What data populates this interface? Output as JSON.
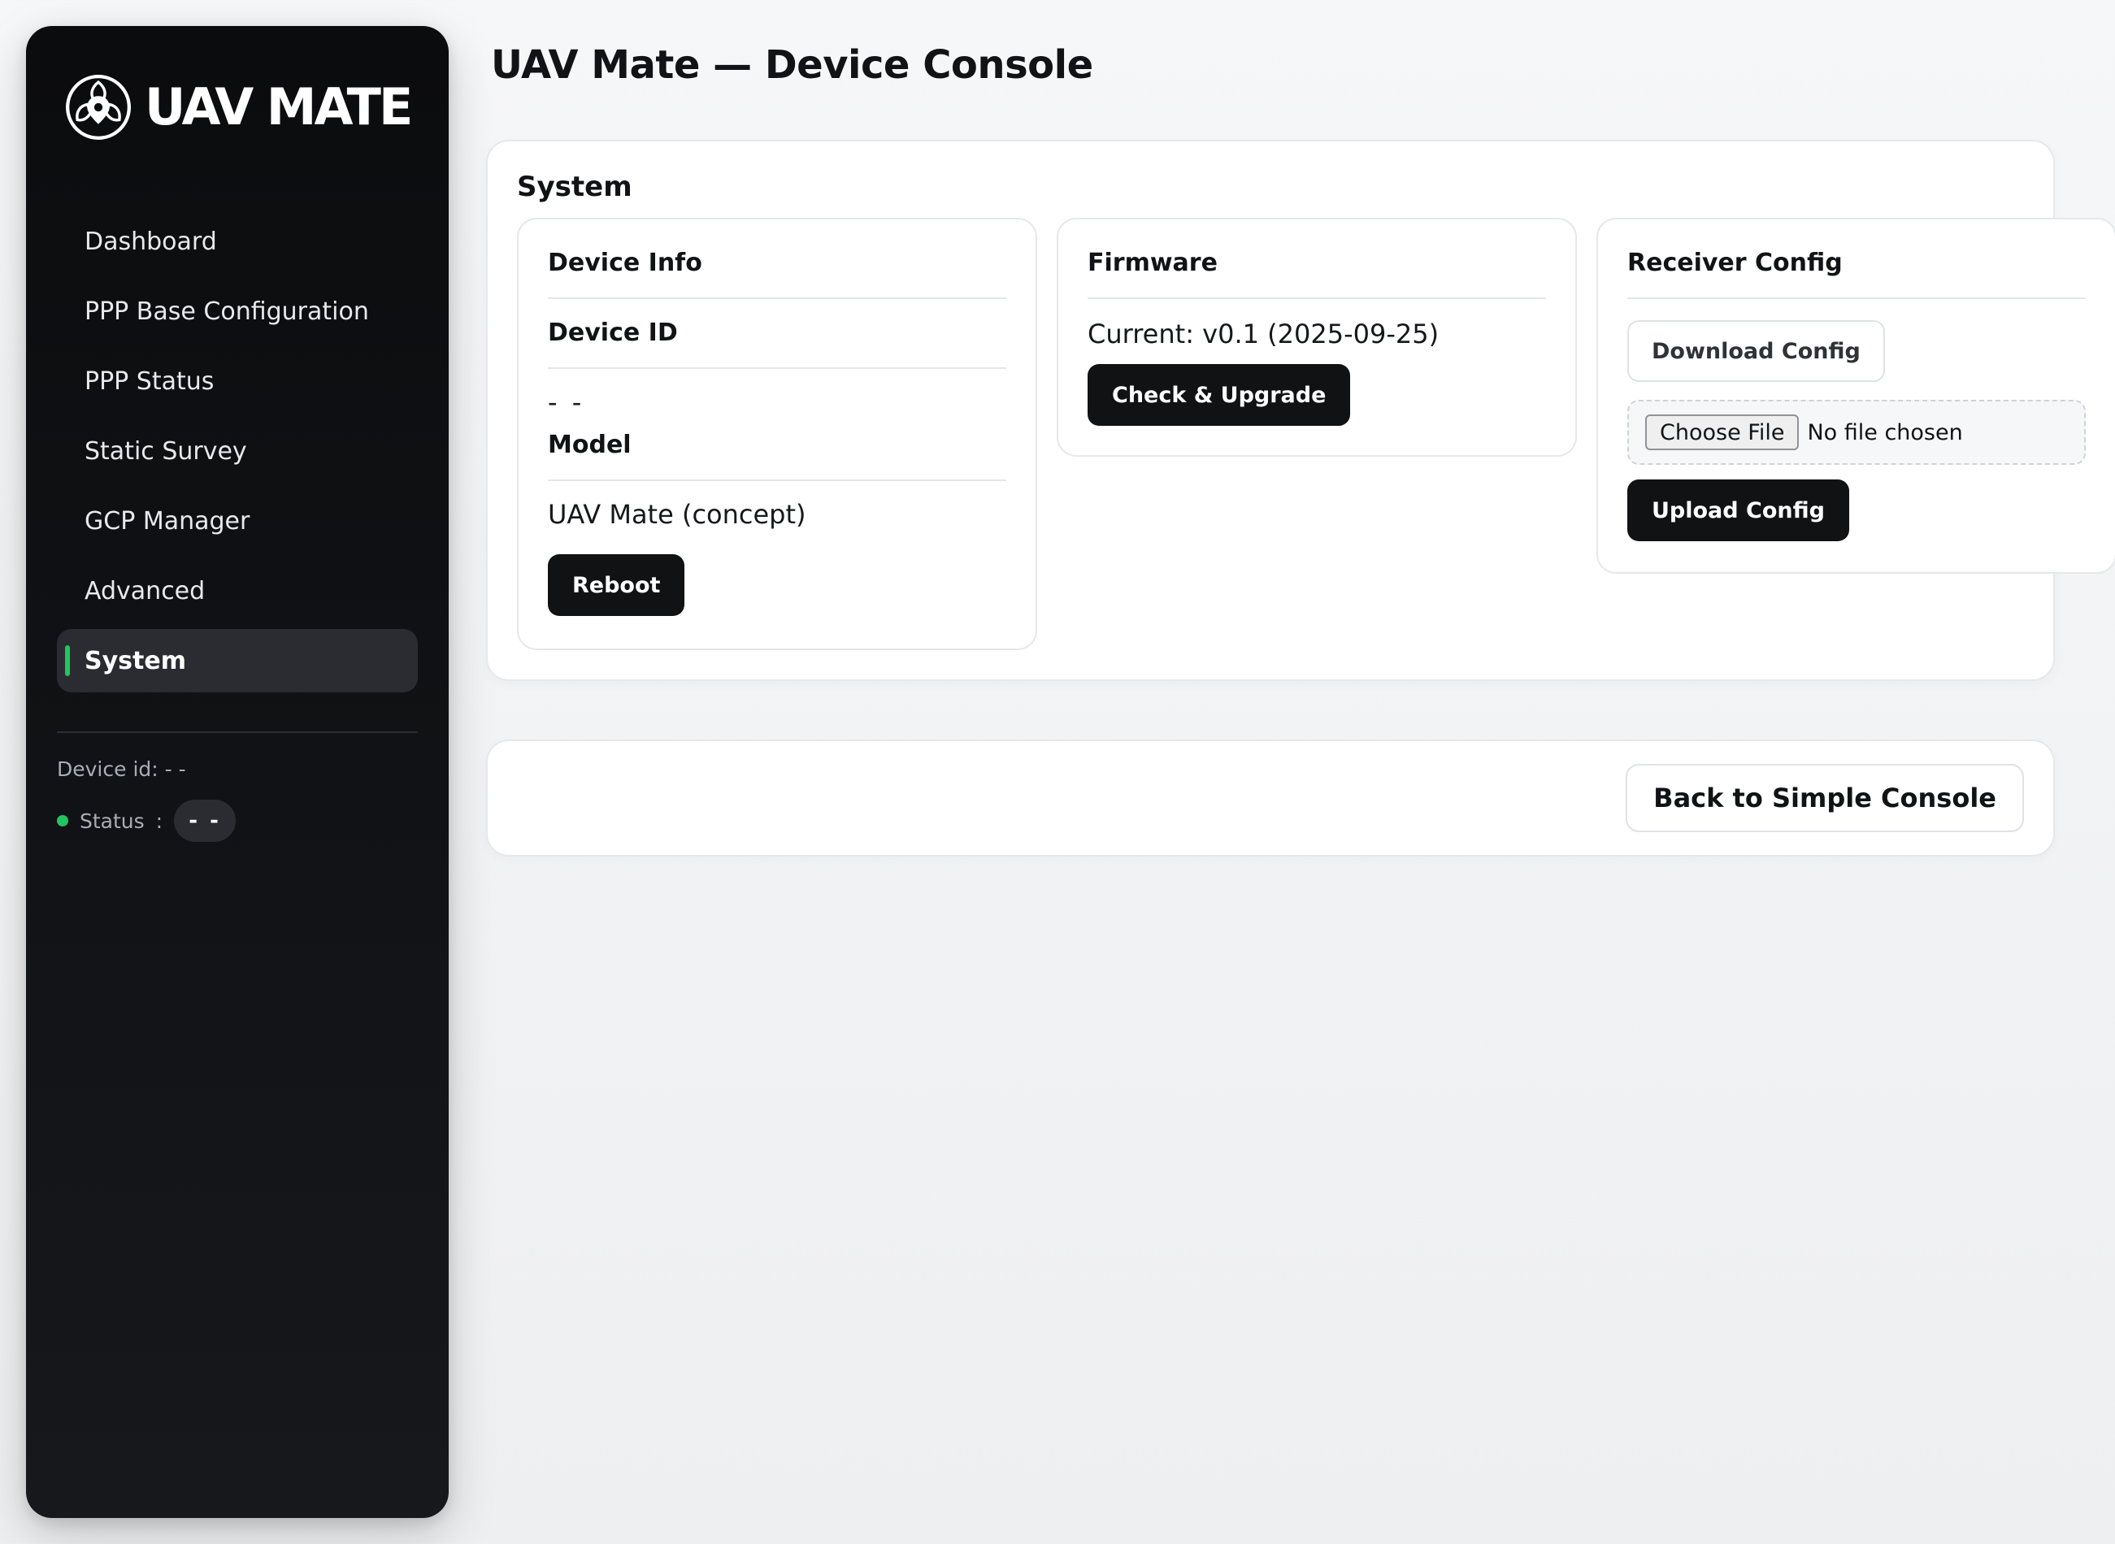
{
  "brand": {
    "name": "UAV MATE",
    "logo_icon": "drone-propeller-pin-icon"
  },
  "sidebar": {
    "items": [
      {
        "label": "Dashboard",
        "active": false
      },
      {
        "label": "PPP Base Configuration",
        "active": false
      },
      {
        "label": "PPP Status",
        "active": false
      },
      {
        "label": "Static Survey",
        "active": false
      },
      {
        "label": "GCP Manager",
        "active": false
      },
      {
        "label": "Advanced",
        "active": false
      },
      {
        "label": "System",
        "active": true
      }
    ],
    "device_id_text": "Device id: - -",
    "status_label": "Status",
    "status_separator": ":",
    "status_value": "- -",
    "status_color": "#22c55e"
  },
  "header": {
    "title": "UAV Mate — Device Console"
  },
  "system": {
    "title": "System",
    "device_info": {
      "title": "Device Info",
      "device_id_label": "Device ID",
      "device_id_value": "- -",
      "model_label": "Model",
      "model_value": "UAV Mate (concept)",
      "reboot_label": "Reboot"
    },
    "firmware": {
      "title": "Firmware",
      "current_text": "Current: v0.1 (2025-09-25)",
      "upgrade_label": "Check & Upgrade"
    },
    "receiver_config": {
      "title": "Receiver Config",
      "download_label": "Download Config",
      "choose_file_label": "Choose File",
      "file_status": "No file chosen",
      "upload_label": "Upload Config"
    }
  },
  "footer": {
    "back_label": "Back to Simple Console"
  },
  "colors": {
    "accent": "#22c55e",
    "sidebar_bg": "#0b0c0e",
    "button_dark": "#111214"
  }
}
